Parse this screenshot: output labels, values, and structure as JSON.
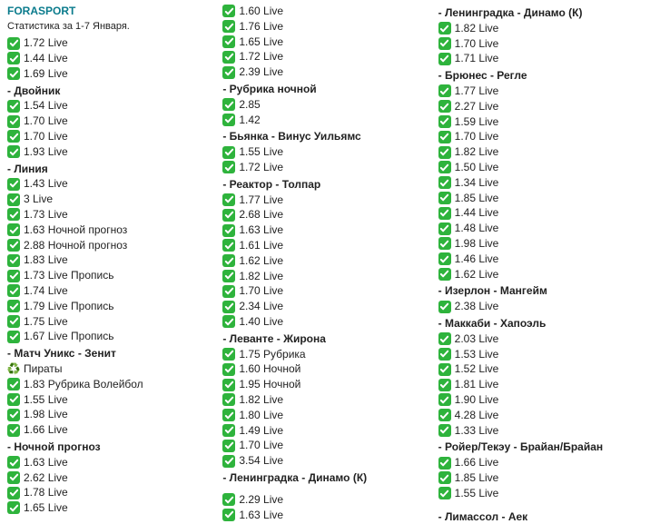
{
  "brand": "FORASPORT",
  "subtitle": "Статистика за 1-7 Января.",
  "icons": {
    "recycle": "♻️"
  },
  "col1": [
    {
      "t": "chk",
      "txt": "1.72 Live"
    },
    {
      "t": "chk",
      "txt": "1.44 Live"
    },
    {
      "t": "chk",
      "txt": "1.69 Live"
    },
    {
      "t": "hdr",
      "txt": "- Двойник"
    },
    {
      "t": "chk",
      "txt": "1.54 Live"
    },
    {
      "t": "chk",
      "txt": "1.70 Live"
    },
    {
      "t": "chk",
      "txt": "1.70 Live"
    },
    {
      "t": "chk",
      "txt": "1.93 Live"
    },
    {
      "t": "hdr",
      "txt": "- Линия"
    },
    {
      "t": "chk",
      "txt": "1.43 Live"
    },
    {
      "t": "chk",
      "txt": "3 Live"
    },
    {
      "t": "chk",
      "txt": "1.73 Live"
    },
    {
      "t": "chk",
      "txt": "1.63 Ночной прогноз"
    },
    {
      "t": "chk",
      "txt": "2.88 Ночной прогноз"
    },
    {
      "t": "chk",
      "txt": "1.83 Live"
    },
    {
      "t": "chk",
      "txt": "1.73 Live Пропись"
    },
    {
      "t": "chk",
      "txt": "1.74 Live"
    },
    {
      "t": "chk",
      "txt": "1.79 Live Пропись"
    },
    {
      "t": "chk",
      "txt": "1.75 Live"
    },
    {
      "t": "chk",
      "txt": "1.67 Live Пропись"
    },
    {
      "t": "hdr",
      "txt": "- Матч Уникс - Зенит"
    },
    {
      "t": "recycle",
      "txt": "Пираты"
    },
    {
      "t": "chk",
      "txt": "1.83 Рубрика Волейбол"
    },
    {
      "t": "chk",
      "txt": "1.55 Live"
    },
    {
      "t": "chk",
      "txt": "1.98 Live"
    },
    {
      "t": "chk",
      "txt": "1.66 Live"
    },
    {
      "t": "hdr",
      "txt": "- Ночной прогноз"
    },
    {
      "t": "chk",
      "txt": "1.63 Live"
    },
    {
      "t": "chk",
      "txt": "2.62 Live"
    },
    {
      "t": "chk",
      "txt": "1.78 Live"
    },
    {
      "t": "chk",
      "txt": "1.65 Live"
    }
  ],
  "col2": [
    {
      "t": "chk",
      "txt": "1.60 Live"
    },
    {
      "t": "chk",
      "txt": "1.76 Live"
    },
    {
      "t": "chk",
      "txt": "1.65 Live"
    },
    {
      "t": "chk",
      "txt": "1.72 Live"
    },
    {
      "t": "chk",
      "txt": "2.39 Live"
    },
    {
      "t": "hdr",
      "txt": "- Рубрика ночной"
    },
    {
      "t": "chk",
      "txt": "2.85"
    },
    {
      "t": "chk",
      "txt": "1.42"
    },
    {
      "t": "hdr",
      "txt": "- Бьянка - Винус Уильямс"
    },
    {
      "t": "chk",
      "txt": "1.55 Live"
    },
    {
      "t": "chk",
      "txt": "1.72 Live"
    },
    {
      "t": "hdr",
      "txt": "- Реактор - Толпар"
    },
    {
      "t": "chk",
      "txt": "1.77 Live"
    },
    {
      "t": "chk",
      "txt": "2.68 Live"
    },
    {
      "t": "chk",
      "txt": "1.63 Live"
    },
    {
      "t": "chk",
      "txt": "1.61 Live"
    },
    {
      "t": "chk",
      "txt": "1.62 Live"
    },
    {
      "t": "chk",
      "txt": "1.82 Live"
    },
    {
      "t": "chk",
      "txt": "1.70 Live"
    },
    {
      "t": "chk",
      "txt": "2.34 Live"
    },
    {
      "t": "chk",
      "txt": "1.40 Live"
    },
    {
      "t": "hdr",
      "txt": "- Леванте - Жирона"
    },
    {
      "t": "chk",
      "txt": "1.75 Рубрика"
    },
    {
      "t": "chk",
      "txt": "1.60 Ночной"
    },
    {
      "t": "chk",
      "txt": "1.95 Ночной"
    },
    {
      "t": "chk",
      "txt": "1.82 Live"
    },
    {
      "t": "chk",
      "txt": "1.80 Live"
    },
    {
      "t": "chk",
      "txt": "1.49 Live"
    },
    {
      "t": "chk",
      "txt": "1.70 Live"
    },
    {
      "t": "chk",
      "txt": "3.54 Live"
    },
    {
      "t": "hdr",
      "txt": "- Ленинградка - Динамо (К)"
    },
    {
      "t": "spacer"
    },
    {
      "t": "chk",
      "txt": "2.29 Live"
    },
    {
      "t": "chk",
      "txt": "1.63 Live"
    }
  ],
  "col3": [
    {
      "t": "hdr",
      "txt": "- Ленинградка - Динамо (К)"
    },
    {
      "t": "chk",
      "txt": "1.82 Live"
    },
    {
      "t": "chk",
      "txt": "1.70 Live"
    },
    {
      "t": "chk",
      "txt": "1.71 Live"
    },
    {
      "t": "hdr",
      "txt": "- Брюнес - Регле"
    },
    {
      "t": "chk",
      "txt": "1.77 Live"
    },
    {
      "t": "chk",
      "txt": "2.27 Live"
    },
    {
      "t": "chk",
      "txt": "1.59 Live"
    },
    {
      "t": "chk",
      "txt": "1.70 Live"
    },
    {
      "t": "chk",
      "txt": "1.82 Live"
    },
    {
      "t": "chk",
      "txt": "1.50 Live"
    },
    {
      "t": "chk",
      "txt": "1.34 Live"
    },
    {
      "t": "chk",
      "txt": "1.85 Live"
    },
    {
      "t": "chk",
      "txt": "1.44 Live"
    },
    {
      "t": "chk",
      "txt": "1.48 Live"
    },
    {
      "t": "chk",
      "txt": "1.98 Live"
    },
    {
      "t": "chk",
      "txt": "1.46 Live"
    },
    {
      "t": "chk",
      "txt": "1.62 Live"
    },
    {
      "t": "hdr",
      "txt": "- Изерлон - Мангейм"
    },
    {
      "t": "chk",
      "txt": "2.38 Live"
    },
    {
      "t": "hdr",
      "txt": "- Маккаби - Хапоэль"
    },
    {
      "t": "chk",
      "txt": "2.03 Live"
    },
    {
      "t": "chk",
      "txt": "1.53 Live"
    },
    {
      "t": "chk",
      "txt": "1.52 Live"
    },
    {
      "t": "chk",
      "txt": "1.81 Live"
    },
    {
      "t": "chk",
      "txt": "1.90 Live"
    },
    {
      "t": "chk",
      "txt": "4.28 Live"
    },
    {
      "t": "chk",
      "txt": "1.33 Live"
    },
    {
      "t": "hdr",
      "txt": "- Ройер/Текэу - Брайан/Брайан"
    },
    {
      "t": "chk",
      "txt": "1.66 Live"
    },
    {
      "t": "chk",
      "txt": "1.85 Live"
    },
    {
      "t": "chk",
      "txt": "1.55 Live"
    },
    {
      "t": "spacer"
    },
    {
      "t": "hdr",
      "txt": "- Лимассол - Аек"
    }
  ]
}
